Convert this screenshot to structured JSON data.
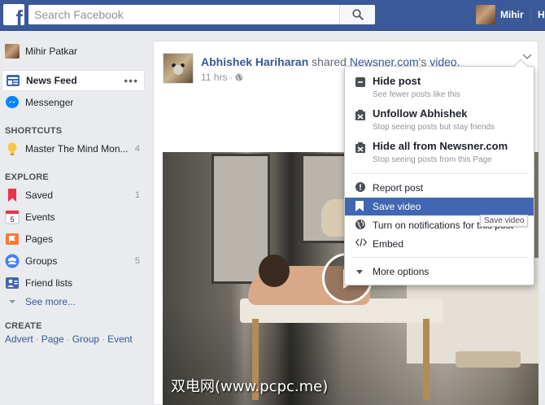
{
  "topbar": {
    "logo_letter": "f",
    "search_placeholder": "Search Facebook",
    "user_name": "Mihir",
    "home_label": "H"
  },
  "leftnav": {
    "profile_name": "Mihir Patkar",
    "primary": [
      {
        "label": "News Feed",
        "icon": "news-feed-icon",
        "more": "•••"
      },
      {
        "label": "Messenger",
        "icon": "messenger-icon"
      }
    ],
    "shortcuts_title": "SHORTCUTS",
    "shortcuts": [
      {
        "label": "Master The Mind Mon...",
        "count": "4",
        "icon": "lightbulb-icon"
      }
    ],
    "explore_title": "EXPLORE",
    "explore": [
      {
        "label": "Saved",
        "count": "1",
        "icon": "bookmark-icon"
      },
      {
        "label": "Events",
        "count": "",
        "icon": "calendar-icon",
        "icon_text": "5"
      },
      {
        "label": "Pages",
        "count": "",
        "icon": "flag-icon"
      },
      {
        "label": "Groups",
        "count": "5",
        "icon": "groups-icon"
      },
      {
        "label": "Friend lists",
        "count": "",
        "icon": "friend-lists-icon"
      }
    ],
    "see_more": "See more...",
    "create_title": "CREATE",
    "create_links": [
      "Advert",
      "Page",
      "Group",
      "Event"
    ]
  },
  "post": {
    "author": "Abhishek Hariharan",
    "action_text": "shared",
    "page": "Newsner.com",
    "object_text": "'s",
    "object_link": "video.",
    "time": "11 hrs",
    "separator": "·"
  },
  "menu": {
    "big_items": [
      {
        "title": "Hide post",
        "sub": "See fewer posts like this",
        "icon": "hide-post-icon"
      },
      {
        "title": "Unfollow Abhishek",
        "sub": "Stop seeing posts but stay friends",
        "icon": "unfollow-icon"
      },
      {
        "title": "Hide all from Newsner.com",
        "sub": "Stop seeing posts from this Page",
        "icon": "hide-all-icon"
      }
    ],
    "items": [
      {
        "label": "Report post",
        "icon": "report-icon"
      },
      {
        "label": "Save video",
        "icon": "bookmark-icon",
        "highlighted": true
      },
      {
        "label": "Turn on notifications for this post",
        "icon": "globe-icon"
      },
      {
        "label": "Embed",
        "icon": "embed-icon"
      },
      {
        "label": "More options",
        "icon": "caret-down-icon"
      }
    ],
    "tooltip": "Save video"
  },
  "watermark": "双电网(www.pcpc.me)",
  "colors": {
    "brand_blue": "#3b5998",
    "link_blue": "#365899",
    "highlight_blue": "#4267b2",
    "page_bg": "#e9ebee"
  }
}
